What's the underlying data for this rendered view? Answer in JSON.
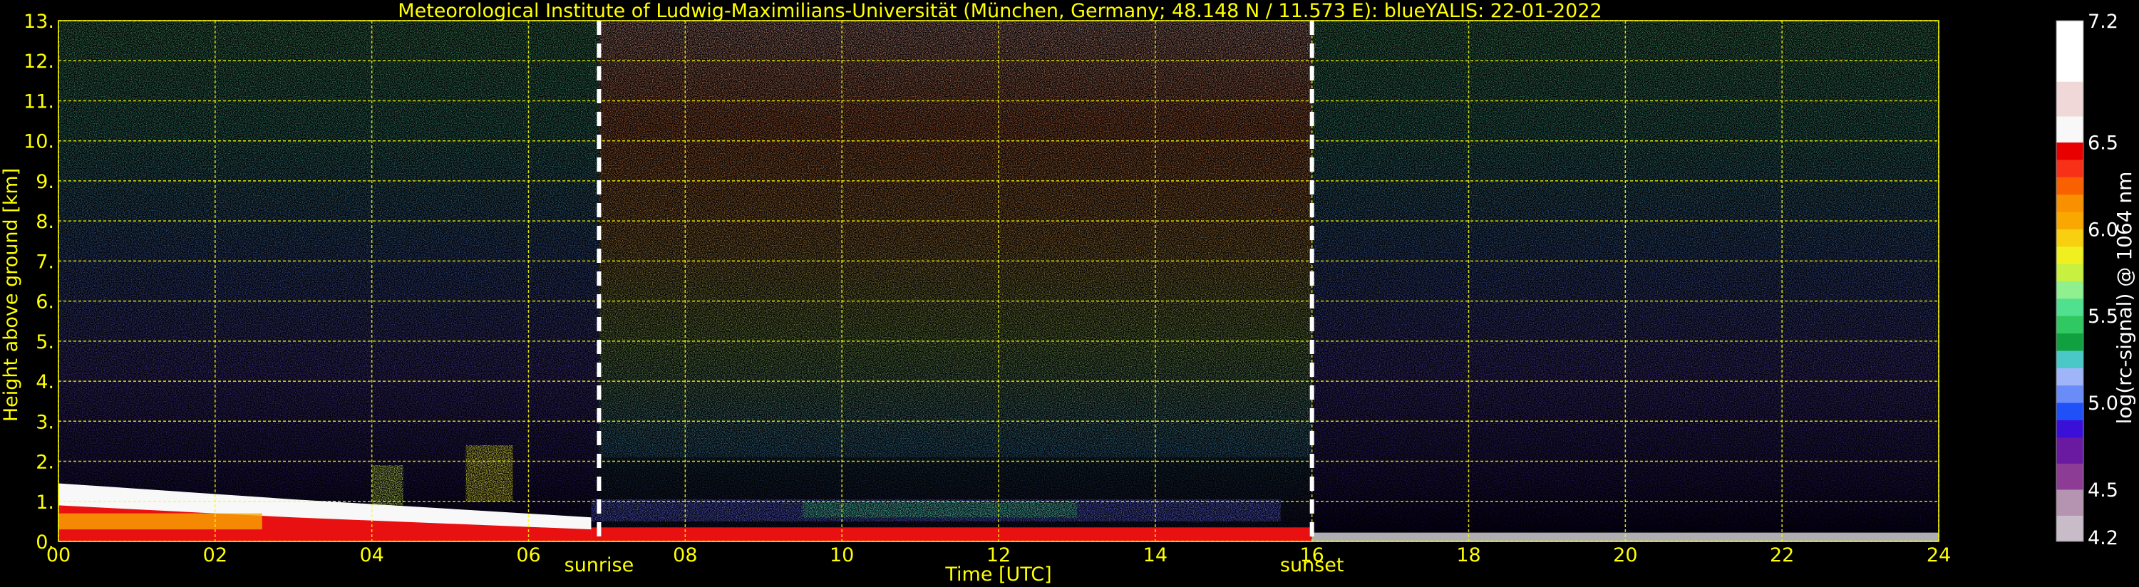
{
  "chart_data": {
    "type": "heatmap",
    "title": "Meteorological Institute of Ludwig-Maximilians-Universität (München, Germany; 48.148 N / 11.573 E):    blueYALIS: 22-01-2022",
    "xlabel": "Time [UTC]",
    "ylabel": "Height above ground [km]",
    "xlim": [
      0,
      24
    ],
    "ylim": [
      0,
      13
    ],
    "x_ticks": [
      0,
      2,
      4,
      6,
      8,
      10,
      12,
      14,
      16,
      18,
      20,
      22,
      24
    ],
    "x_tick_labels": [
      "00",
      "02",
      "04",
      "06",
      "08",
      "10",
      "12",
      "14",
      "16",
      "18",
      "20",
      "22",
      "24"
    ],
    "y_ticks": [
      0,
      1,
      2,
      3,
      4,
      5,
      6,
      7,
      8,
      9,
      10,
      11,
      12,
      13
    ],
    "y_tick_labels": [
      "0.",
      "1.",
      "2.",
      "3.",
      "4.",
      "5.",
      "6.",
      "7.",
      "8.",
      "9.",
      "10.",
      "11.",
      "12.",
      "13."
    ],
    "grid": true,
    "annotations": [
      {
        "text": "sunrise",
        "x": 6.9
      },
      {
        "text": "sunset",
        "x": 16.0
      }
    ],
    "colorbar": {
      "label": "log(rc-signal) @ 1064 nm",
      "range": [
        4.2,
        7.2
      ],
      "tick_values": [
        4.2,
        4.5,
        5.0,
        5.5,
        6.0,
        6.5,
        7.2
      ],
      "tick_labels": [
        "4.2",
        "4.5",
        "5.0",
        "5.5",
        "6.0",
        "6.5",
        "7.2"
      ],
      "colors": [
        {
          "v0": 4.2,
          "v1": 4.35,
          "color": "#c8bcc8"
        },
        {
          "v0": 4.35,
          "v1": 4.5,
          "color": "#b494b0"
        },
        {
          "v0": 4.5,
          "v1": 4.65,
          "color": "#8c3c94"
        },
        {
          "v0": 4.65,
          "v1": 4.8,
          "color": "#6a1aa0"
        },
        {
          "v0": 4.8,
          "v1": 4.9,
          "color": "#3a10d8"
        },
        {
          "v0": 4.9,
          "v1": 5.0,
          "color": "#2050f8"
        },
        {
          "v0": 5.0,
          "v1": 5.1,
          "color": "#6a8cf8"
        },
        {
          "v0": 5.1,
          "v1": 5.2,
          "color": "#a0b4fa"
        },
        {
          "v0": 5.2,
          "v1": 5.3,
          "color": "#4ac8c8"
        },
        {
          "v0": 5.3,
          "v1": 5.4,
          "color": "#10a040"
        },
        {
          "v0": 5.4,
          "v1": 5.5,
          "color": "#30c860"
        },
        {
          "v0": 5.5,
          "v1": 5.6,
          "color": "#50e090"
        },
        {
          "v0": 5.6,
          "v1": 5.7,
          "color": "#90f090"
        },
        {
          "v0": 5.7,
          "v1": 5.8,
          "color": "#c8f040"
        },
        {
          "v0": 5.8,
          "v1": 5.9,
          "color": "#f0f020"
        },
        {
          "v0": 5.9,
          "v1": 6.0,
          "color": "#f8d010"
        },
        {
          "v0": 6.0,
          "v1": 6.1,
          "color": "#f8a800"
        },
        {
          "v0": 6.1,
          "v1": 6.2,
          "color": "#f89000"
        },
        {
          "v0": 6.2,
          "v1": 6.3,
          "color": "#f86000"
        },
        {
          "v0": 6.3,
          "v1": 6.4,
          "color": "#f83018"
        },
        {
          "v0": 6.4,
          "v1": 6.5,
          "color": "#e80000"
        },
        {
          "v0": 6.5,
          "v1": 6.65,
          "color": "#f8f8f8"
        },
        {
          "v0": 6.65,
          "v1": 6.85,
          "color": "#f0d8d8"
        },
        {
          "v0": 6.85,
          "v1": 7.2,
          "color": "#ffffff"
        }
      ]
    }
  },
  "colors": {
    "background": "#000000",
    "text_accent": "#ffff00",
    "text_white": "#ffffff",
    "grid": "#ffff00"
  }
}
